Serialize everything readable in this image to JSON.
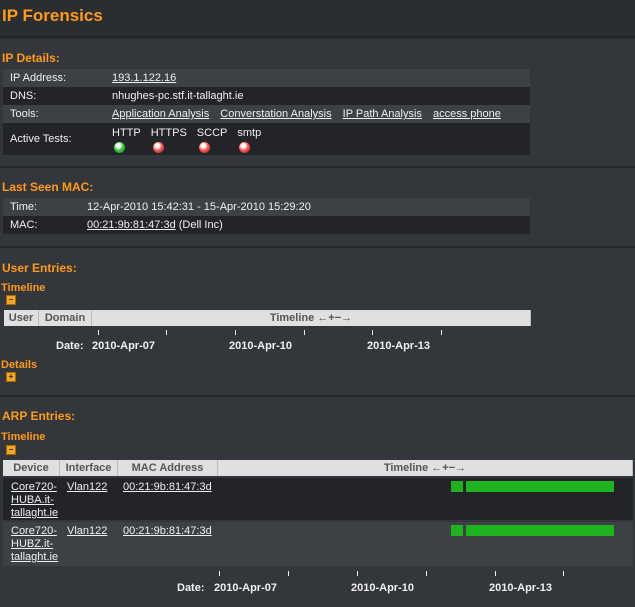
{
  "header": {
    "title": "IP Forensics"
  },
  "ip_details": {
    "title": "IP Details:",
    "rows": {
      "ip": {
        "label": "IP Address:",
        "value": "193.1.122.16"
      },
      "dns": {
        "label": "DNS:",
        "value": "nhughes-pc.stf.it-tallaght.ie"
      },
      "tools": {
        "label": "Tools:",
        "links": [
          "Application Analysis",
          "Converstation Analysis",
          "IP Path Analysis",
          "access phone"
        ]
      },
      "tests": {
        "label": "Active Tests:",
        "items": [
          {
            "name": "HTTP",
            "status": "green"
          },
          {
            "name": "HTTPS",
            "status": "red"
          },
          {
            "name": "SCCP",
            "status": "red"
          },
          {
            "name": "smtp",
            "status": "red"
          }
        ]
      }
    }
  },
  "last_seen_mac": {
    "title": "Last Seen MAC:",
    "time_label": "Time:",
    "time_value": "12-Apr-2010 15:42:31 - 15-Apr-2010 15:29:20",
    "mac_label": "MAC:",
    "mac_value": "00:21:9b:81:47:3d",
    "mac_vendor": "(Dell Inc)"
  },
  "user_entries": {
    "title": "User Entries:",
    "timeline_label": "Timeline",
    "columns": [
      "User",
      "Domain",
      "Timeline ←+−→"
    ],
    "date_label": "Date:",
    "dates": [
      "2010-Apr-07",
      "2010-Apr-10",
      "2010-Apr-13"
    ],
    "details_label": "Details"
  },
  "arp_entries": {
    "title": "ARP Entries:",
    "timeline_label": "Timeline",
    "columns": [
      "Device",
      "Interface",
      "MAC Address",
      "Timeline ←+−→"
    ],
    "rows": [
      {
        "device": "Core720-HUBA.it-tallaght.ie",
        "interface": "Vlan122",
        "mac": "00:21:9b:81:47:3d"
      },
      {
        "device": "Core720-HUBZ.it-tallaght.ie",
        "interface": "Vlan122",
        "mac": "00:21:9b:81:47:3d"
      }
    ],
    "date_label": "Date:",
    "dates": [
      "2010-Apr-07",
      "2010-Apr-10",
      "2010-Apr-13"
    ]
  },
  "colors": {
    "accent": "#ff9a1a",
    "bar": "#1fb41f",
    "ok": "#3fcc3f",
    "fail": "#ff5a5a"
  }
}
